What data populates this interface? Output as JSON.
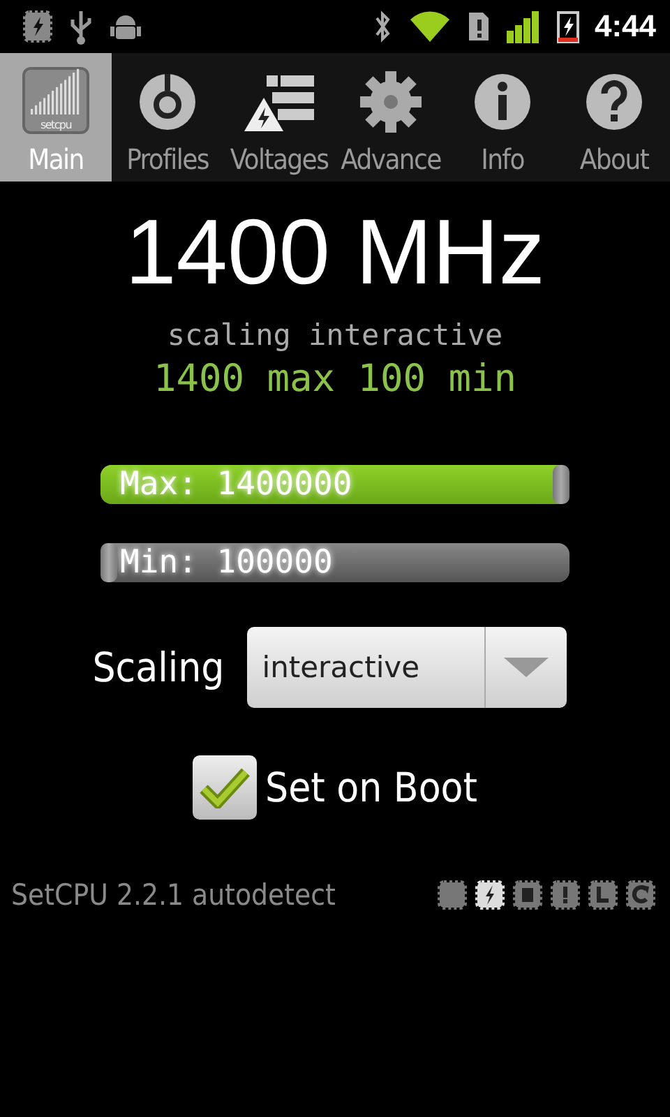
{
  "status_bar": {
    "time": "4:44"
  },
  "tabs": [
    {
      "label": "Main",
      "kind": "logo",
      "selected": true
    },
    {
      "label": "Profiles",
      "kind": "ring",
      "selected": false
    },
    {
      "label": "Voltages",
      "kind": "list",
      "selected": false
    },
    {
      "label": "Advance",
      "kind": "gear",
      "selected": false
    },
    {
      "label": "Info",
      "kind": "info",
      "selected": false
    },
    {
      "label": "About",
      "kind": "help",
      "selected": false
    }
  ],
  "logo_text": "setcpu",
  "frequency": "1400 MHz",
  "governor_line": "scaling interactive",
  "range_line": "1400 max 100 min",
  "sliders": [
    {
      "label": "Max: 1400000",
      "level": 1.0
    },
    {
      "label": "Min: 100000",
      "level": 0.0
    }
  ],
  "scaling": {
    "label": "Scaling",
    "value": "interactive"
  },
  "set_on_boot": {
    "label": "Set on Boot",
    "checked": true
  },
  "footer": {
    "text": "SetCPU 2.2.1 autodetect",
    "chips": [
      {
        "kind": "plain",
        "selected": false
      },
      {
        "kind": "bolt",
        "selected": true
      },
      {
        "kind": "chip",
        "selected": false
      },
      {
        "kind": "alert",
        "selected": false
      },
      {
        "kind": "clock",
        "selected": false
      },
      {
        "kind": "refresh",
        "selected": false
      }
    ]
  }
}
